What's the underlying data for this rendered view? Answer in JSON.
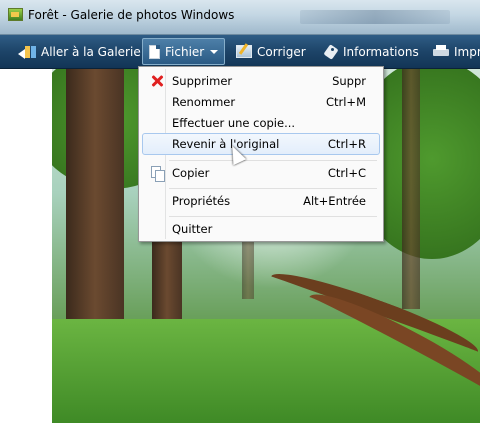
{
  "window": {
    "title": "Forêt - Galerie de photos Windows"
  },
  "toolbar": {
    "items": [
      {
        "label": "Aller à la Galerie",
        "icon": "back-to-gallery-icon"
      },
      {
        "label": "Fichier",
        "icon": "file-icon"
      },
      {
        "label": "Corriger",
        "icon": "fix-icon"
      },
      {
        "label": "Informations",
        "icon": "info-tag-icon"
      },
      {
        "label": "Impri",
        "icon": "print-icon"
      }
    ]
  },
  "file_menu": {
    "items": [
      {
        "label": "Supprimer",
        "shortcut": "Suppr",
        "icon": "delete-x-icon"
      },
      {
        "label": "Renommer",
        "shortcut": "Ctrl+M"
      },
      {
        "label": "Effectuer une copie...",
        "shortcut": ""
      },
      {
        "label": "Revenir à l'original",
        "shortcut": "Ctrl+R",
        "highlighted": true
      },
      {
        "label": "Copier",
        "shortcut": "Ctrl+C",
        "icon": "copy-icon"
      },
      {
        "label": "Propriétés",
        "shortcut": "Alt+Entrée"
      },
      {
        "label": "Quitter",
        "shortcut": ""
      }
    ]
  },
  "colors": {
    "toolbar": "#1d4468",
    "menu_highlight": "#e3eefb",
    "delete_icon": "#e02020"
  }
}
